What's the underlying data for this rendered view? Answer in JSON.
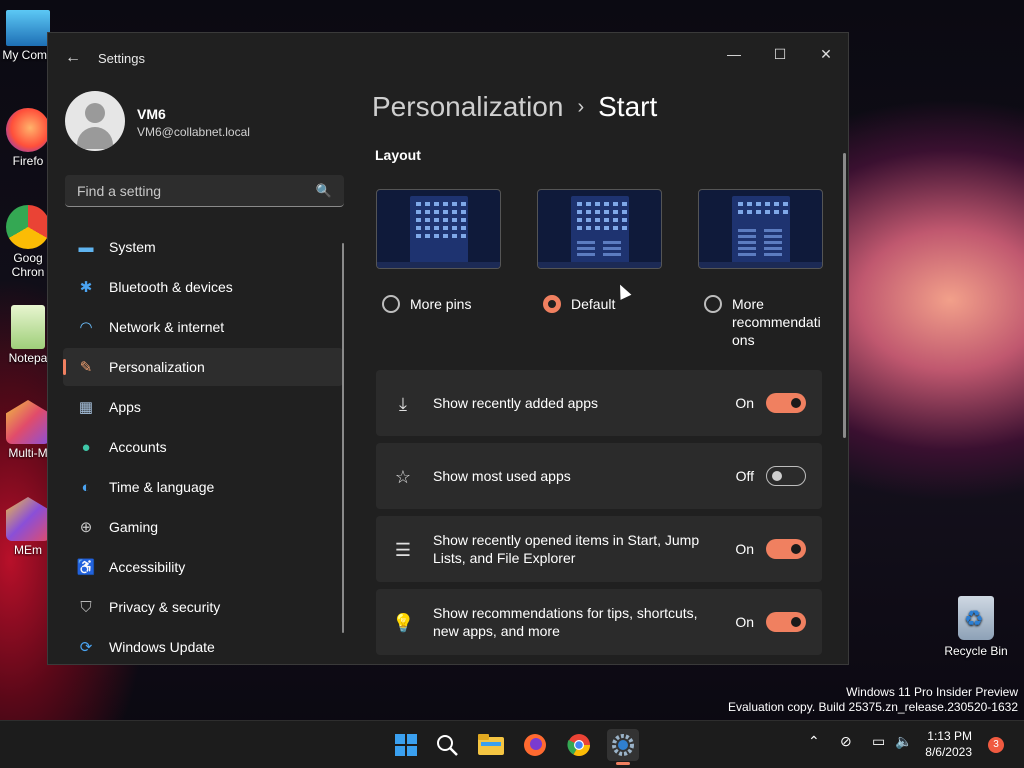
{
  "desktop": {
    "icons": [
      {
        "label": "My Comp",
        "color": "#3aa0e0"
      },
      {
        "label": "Firefo",
        "color": "#ff7139"
      },
      {
        "label": "Goog",
        "label2": "Chron",
        "color": "#3d8ee8"
      },
      {
        "label": "Notepa",
        "color": "#9fcf7a"
      },
      {
        "label": "Multi-M",
        "color": "#e14c6a"
      },
      {
        "label": "MEm",
        "color": "#8a4fd8"
      }
    ],
    "recycle_bin": "Recycle Bin",
    "watermark": {
      "line1": "Windows 11 Pro Insider Preview",
      "line2": "Evaluation copy. Build 25375.zn_release.230520-1632"
    }
  },
  "window": {
    "title": "Settings",
    "back_glyph": "←",
    "minimize_glyph": "—",
    "maximize_glyph": "☐",
    "close_glyph": "✕"
  },
  "profile": {
    "name": "VM6",
    "email": "VM6@collabnet.local"
  },
  "search": {
    "placeholder": "Find a setting",
    "icon": "🔍"
  },
  "nav": [
    {
      "label": "System",
      "icon": "system-icon",
      "glyph": "▬",
      "color": "#5fb4f0"
    },
    {
      "label": "Bluetooth & devices",
      "icon": "bluetooth-icon",
      "glyph": "✱",
      "color": "#4aa3f0"
    },
    {
      "label": "Network & internet",
      "icon": "wifi-icon",
      "glyph": "◠",
      "color": "#6cc0ff"
    },
    {
      "label": "Personalization",
      "icon": "brush-icon",
      "glyph": "✎",
      "color": "#f0a070",
      "active": true
    },
    {
      "label": "Apps",
      "icon": "apps-icon",
      "glyph": "▦",
      "color": "#a9c4e0"
    },
    {
      "label": "Accounts",
      "icon": "accounts-icon",
      "glyph": "●",
      "color": "#3fc7a8"
    },
    {
      "label": "Time & language",
      "icon": "globe-icon",
      "glyph": "◐",
      "color": "#4aa3f0"
    },
    {
      "label": "Gaming",
      "icon": "gamepad-icon",
      "glyph": "⊕",
      "color": "#c8c8c8"
    },
    {
      "label": "Accessibility",
      "icon": "accessibility-icon",
      "glyph": "♿",
      "color": "#4aa3f0"
    },
    {
      "label": "Privacy & security",
      "icon": "shield-icon",
      "glyph": "⛉",
      "color": "#b8b8b8"
    },
    {
      "label": "Windows Update",
      "icon": "update-icon",
      "glyph": "⟳",
      "color": "#4aa3f0"
    }
  ],
  "main": {
    "breadcrumb": {
      "parent": "Personalization",
      "separator": "›",
      "current": "Start"
    },
    "layout": {
      "title": "Layout",
      "options": [
        {
          "label": "More pins",
          "checked": false
        },
        {
          "label": "Default",
          "checked": true
        },
        {
          "label": "More recommendati",
          "label2": "ons",
          "checked": false
        }
      ]
    },
    "settings": [
      {
        "label": "Show recently added apps",
        "state": "On",
        "on": true,
        "icon": "download-icon",
        "glyph": "⤓"
      },
      {
        "label": "Show most used apps",
        "state": "Off",
        "on": false,
        "icon": "star-icon",
        "glyph": "☆"
      },
      {
        "label": "Show recently opened items in Start, Jump Lists, and File Explorer",
        "state": "On",
        "on": true,
        "icon": "list-icon",
        "glyph": "☰"
      },
      {
        "label": "Show recommendations for tips, shortcuts, new apps, and more",
        "state": "On",
        "on": true,
        "icon": "lightbulb-icon",
        "glyph": "💡"
      }
    ]
  },
  "taskbar": {
    "icons": [
      "start-icon",
      "search-icon",
      "file-explorer-icon",
      "firefox-icon",
      "chrome-icon",
      "settings-icon"
    ],
    "tray": {
      "chevron": "⌃",
      "network": "▭",
      "volume": "🔈"
    },
    "time": "1:13 PM",
    "date": "8/6/2023",
    "notifications": "3"
  }
}
